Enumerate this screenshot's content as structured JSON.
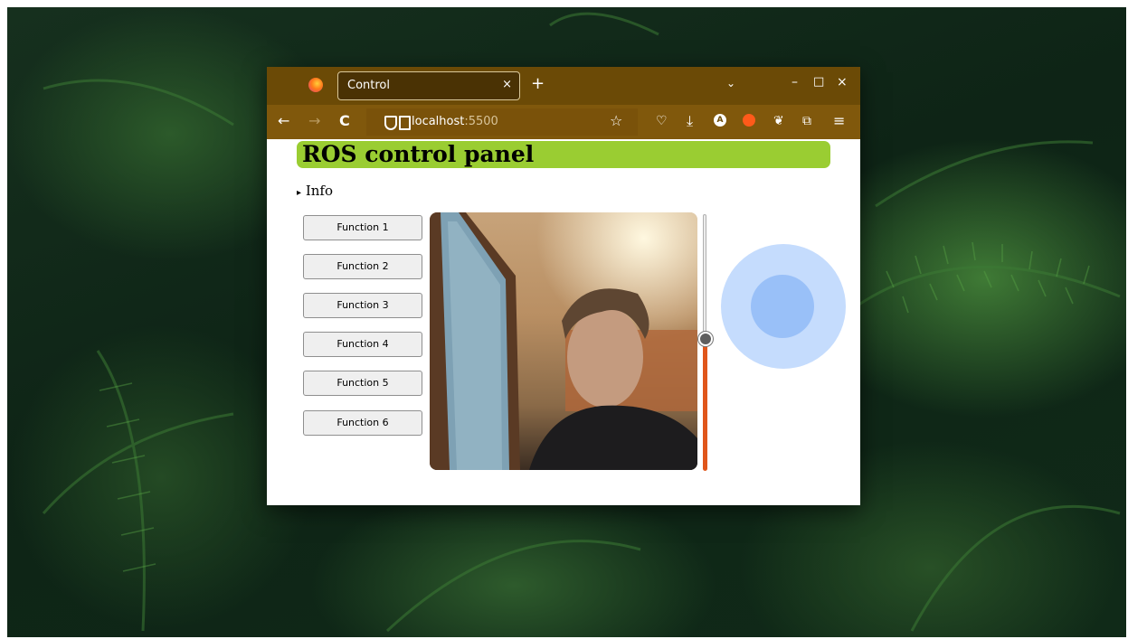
{
  "browser": {
    "tab_title": "Control",
    "tab_close": "×",
    "new_tab": "+",
    "tab_list": "⌄",
    "window_controls": {
      "minimize": "–",
      "maximize": "□",
      "close": "×"
    },
    "nav": {
      "back": "←",
      "forward": "→",
      "reload": "C"
    },
    "url": {
      "host": "localhost",
      "port": ":5500"
    },
    "toolbar_icons": [
      "bookmark-star-icon",
      "pocket-icon",
      "download-icon",
      "account-icon",
      "extension-fox-icon",
      "extension-leaf-icon",
      "extensions-puzzle-icon",
      "menu-icon"
    ],
    "glyphs": {
      "star": "☆",
      "download": "⤓",
      "menu": "≡",
      "account": "A",
      "pocket": "♡",
      "puzzle": "⧉",
      "leaf": "❦"
    }
  },
  "page": {
    "title": "ROS control panel",
    "info_marker": "▸",
    "info_label": "Info",
    "functions": [
      "Function 1",
      "Function 2",
      "Function 3",
      "Function 4",
      "Function 5",
      "Function 6"
    ],
    "slider": {
      "value_fraction": 0.51,
      "orientation": "vertical"
    },
    "joystick": {
      "x": 0,
      "y": 0
    },
    "colors": {
      "title_bar": "#9acd32",
      "slider_fill": "#e0561b",
      "joystick_base": "#c5dcfd",
      "joystick_knob": "#99c0f8",
      "tab_bar": "#6b4a06",
      "nav_bar": "#80580c"
    }
  }
}
